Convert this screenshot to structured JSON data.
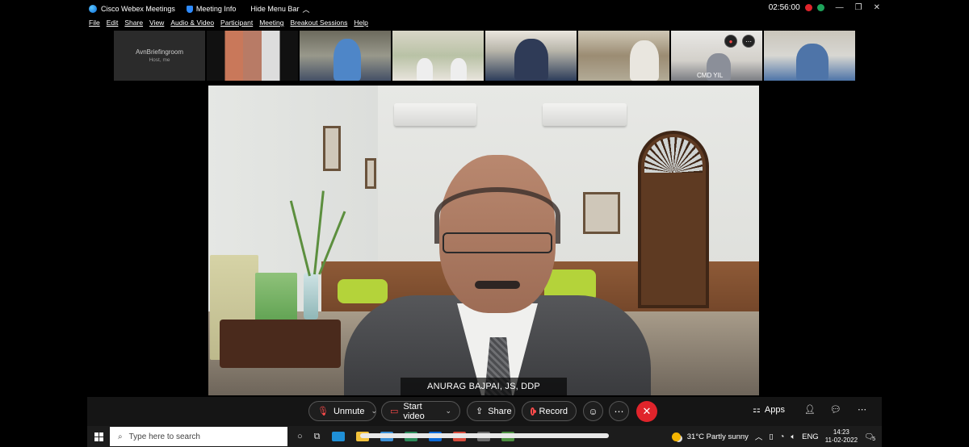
{
  "titlebar": {
    "app_name": "Cisco Webex Meetings",
    "meeting_info": "Meeting Info",
    "hide_menu_bar": "Hide Menu Bar",
    "time": "02:56:00"
  },
  "menu": [
    "File",
    "Edit",
    "Share",
    "View",
    "Audio & Video",
    "Participant",
    "Meeting",
    "Breakout Sessions",
    "Help"
  ],
  "thumbnails": {
    "host_name": "AvnBriefingroom",
    "host_sub": "Host, me",
    "cmd_label": "CMD YIL"
  },
  "main_video": {
    "speaker_name": "ANURAG BAJPAI, JS, DDP"
  },
  "controls": {
    "unmute": "Unmute",
    "start_video": "Start video",
    "share": "Share",
    "record": "Record",
    "apps": "Apps"
  },
  "taskbar": {
    "search_placeholder": "Type here to search",
    "weather": "31°C  Partly sunny",
    "lang": "ENG",
    "time": "14:23",
    "date": "11-02-2022",
    "notif_count": "5"
  },
  "colors": {
    "end_red": "#e0242b",
    "mute_red": "#ff4b4b",
    "webex_blue": "#0a6ad8"
  }
}
